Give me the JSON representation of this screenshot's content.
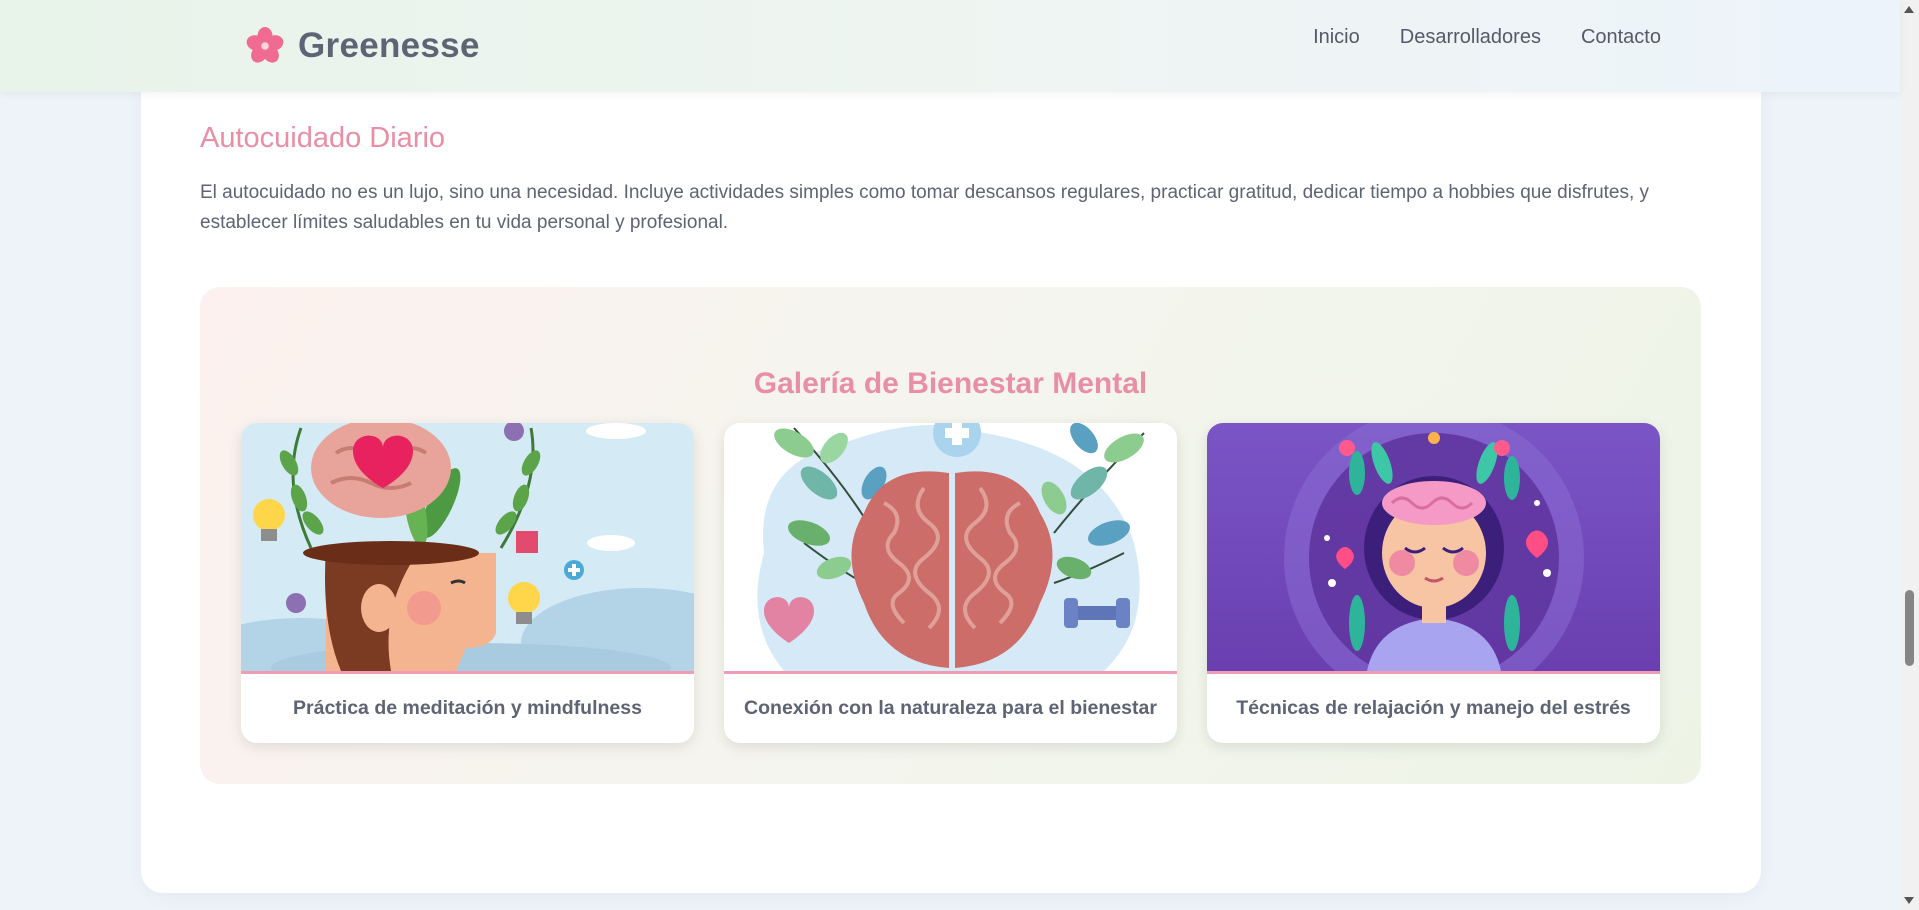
{
  "header": {
    "brand": "Greenesse",
    "logo_icon": "flower-icon",
    "nav": [
      {
        "label": "Inicio"
      },
      {
        "label": "Desarrolladores"
      },
      {
        "label": "Contacto"
      }
    ]
  },
  "section": {
    "title": "Autocuidado Diario",
    "text": "El autocuidado no es un lujo, sino una necesidad. Incluye actividades simples como tomar descansos regulares, practicar gratitud, dedicar tiempo a hobbies que disfrutes, y establecer límites saludables en tu vida personal y profesional."
  },
  "gallery": {
    "title": "Galería de Bienestar Mental",
    "cards": [
      {
        "caption": "Práctica de meditación y mindfulness",
        "image": "head-with-brain-and-plants-illustration"
      },
      {
        "caption": "Conexión con la naturaleza para el bienestar",
        "image": "brain-with-leaves-illustration"
      },
      {
        "caption": "Técnicas de relajación y manejo del estrés",
        "image": "calm-woman-with-flowers-illustration"
      }
    ]
  },
  "colors": {
    "accent_pink": "#e88ea5",
    "text_gray": "#5f6474",
    "page_bg": "#eef2f9"
  }
}
